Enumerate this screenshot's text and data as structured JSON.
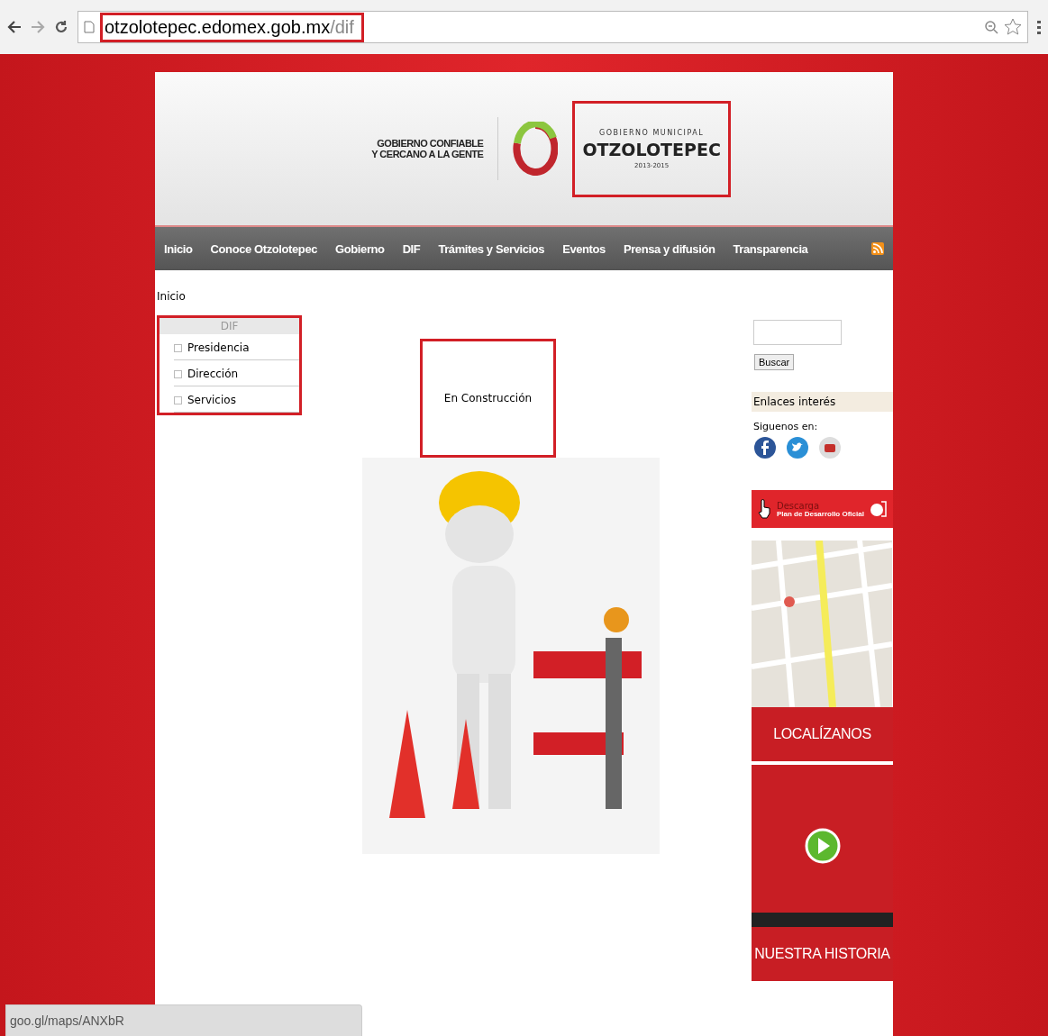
{
  "browser": {
    "url_host": "otzolotepec.edomex.gob.mx",
    "url_path": "/dif",
    "url_highlighted": true
  },
  "header": {
    "slogan_lines": [
      "GOBIERNO CONFIABLE",
      "Y CERCANO A LA GENTE"
    ],
    "overline": "GOBIERNO MUNICIPAL",
    "name": "OTZOLOTEPEC",
    "years": "2013-2015",
    "highlighted": true
  },
  "nav": {
    "items": [
      "Inicio",
      "Conoce Otzolotepec",
      "Gobierno",
      "DIF",
      "Trámites y Servicios",
      "Eventos",
      "Prensa y difusión",
      "Transparencia"
    ]
  },
  "breadcrumb": "Inicio",
  "sidebar": {
    "title": "DIF",
    "highlighted": true,
    "items": [
      {
        "label": "Presidencia"
      },
      {
        "label": "Dirección"
      },
      {
        "label": "Servicios"
      }
    ]
  },
  "main": {
    "message": "En Construcción",
    "highlighted": true
  },
  "right": {
    "search_button": "Buscar",
    "links_title": "Enlaces interés",
    "follow_label": "Siguenos en:",
    "download_title": "Descarga",
    "download_subtitle": "Plan de Desarrollo Oficial",
    "locate_banner": "LOCALÍZANOS",
    "history_banner": "NUESTRA HISTORIA"
  },
  "status_bar": "goo.gl/maps/ANXbR"
}
